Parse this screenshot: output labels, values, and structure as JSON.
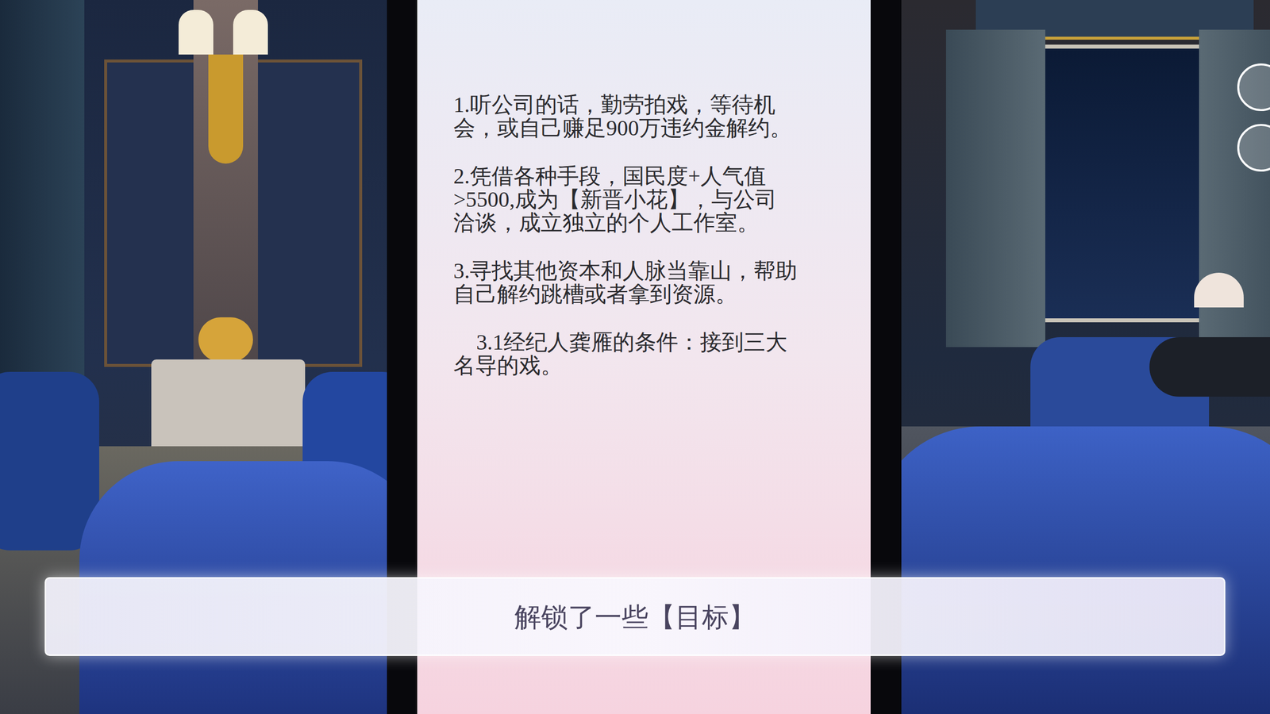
{
  "goals_panel": {
    "items": [
      {
        "kind": "main",
        "lines": [
          "1.听公司的话，勤劳拍戏，等待机",
          "会，或自己赚足900万违约金解约。"
        ]
      },
      {
        "kind": "main",
        "lines": [
          "2.凭借各种手段，国民度+人气值",
          ">5500,成为【新晋小花】，与公司",
          "洽谈，成立独立的个人工作室。"
        ]
      },
      {
        "kind": "main",
        "lines": [
          "3.寻找其他资本和人脉当靠山，帮助",
          "自己解约跳槽或者拿到资源。"
        ]
      },
      {
        "kind": "sub",
        "lines": [
          "3.1经纪人龚雁的条件：接到三大",
          "名导的戏。"
        ]
      }
    ]
  },
  "banner": {
    "text": "解锁了一些【目标】"
  }
}
